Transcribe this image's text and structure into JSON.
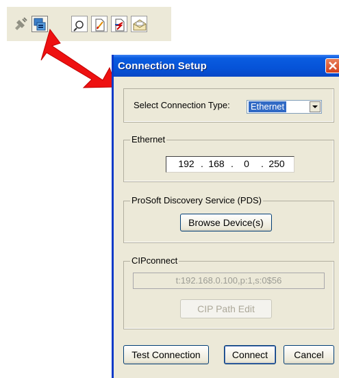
{
  "toolbar": {
    "buttons": [
      {
        "icon": "disconnect-plug-icon",
        "state": "disabled"
      },
      {
        "icon": "connection-setup-icon",
        "state": "pressed"
      },
      {
        "icon": "magnifier-document-icon",
        "state": "normal"
      },
      {
        "icon": "document-edit-icon",
        "state": "normal"
      },
      {
        "icon": "download-arrows-icon",
        "state": "normal"
      },
      {
        "icon": "open-envelope-icon",
        "state": "normal"
      }
    ]
  },
  "dialog": {
    "title": "Connection Setup",
    "connection_type_label": "Select Connection Type:",
    "connection_type_value": "Ethernet",
    "ethernet": {
      "legend": "Ethernet",
      "ip": [
        "192",
        "168",
        "0",
        "250"
      ]
    },
    "pds": {
      "legend": "ProSoft Discovery Service (PDS)",
      "browse_label": "Browse Device(s)"
    },
    "cip": {
      "legend": "CIPconnect",
      "path_value": "t:192.168.0.100,p:1,s:0$56",
      "path_edit_label": "CIP Path Edit"
    },
    "buttons": {
      "test": "Test Connection",
      "connect": "Connect",
      "cancel": "Cancel"
    }
  },
  "colors": {
    "arrow": "#ee1111",
    "titlebar": "#0653d8",
    "dialog_bg": "#ece9d8",
    "selection": "#316ac5"
  }
}
